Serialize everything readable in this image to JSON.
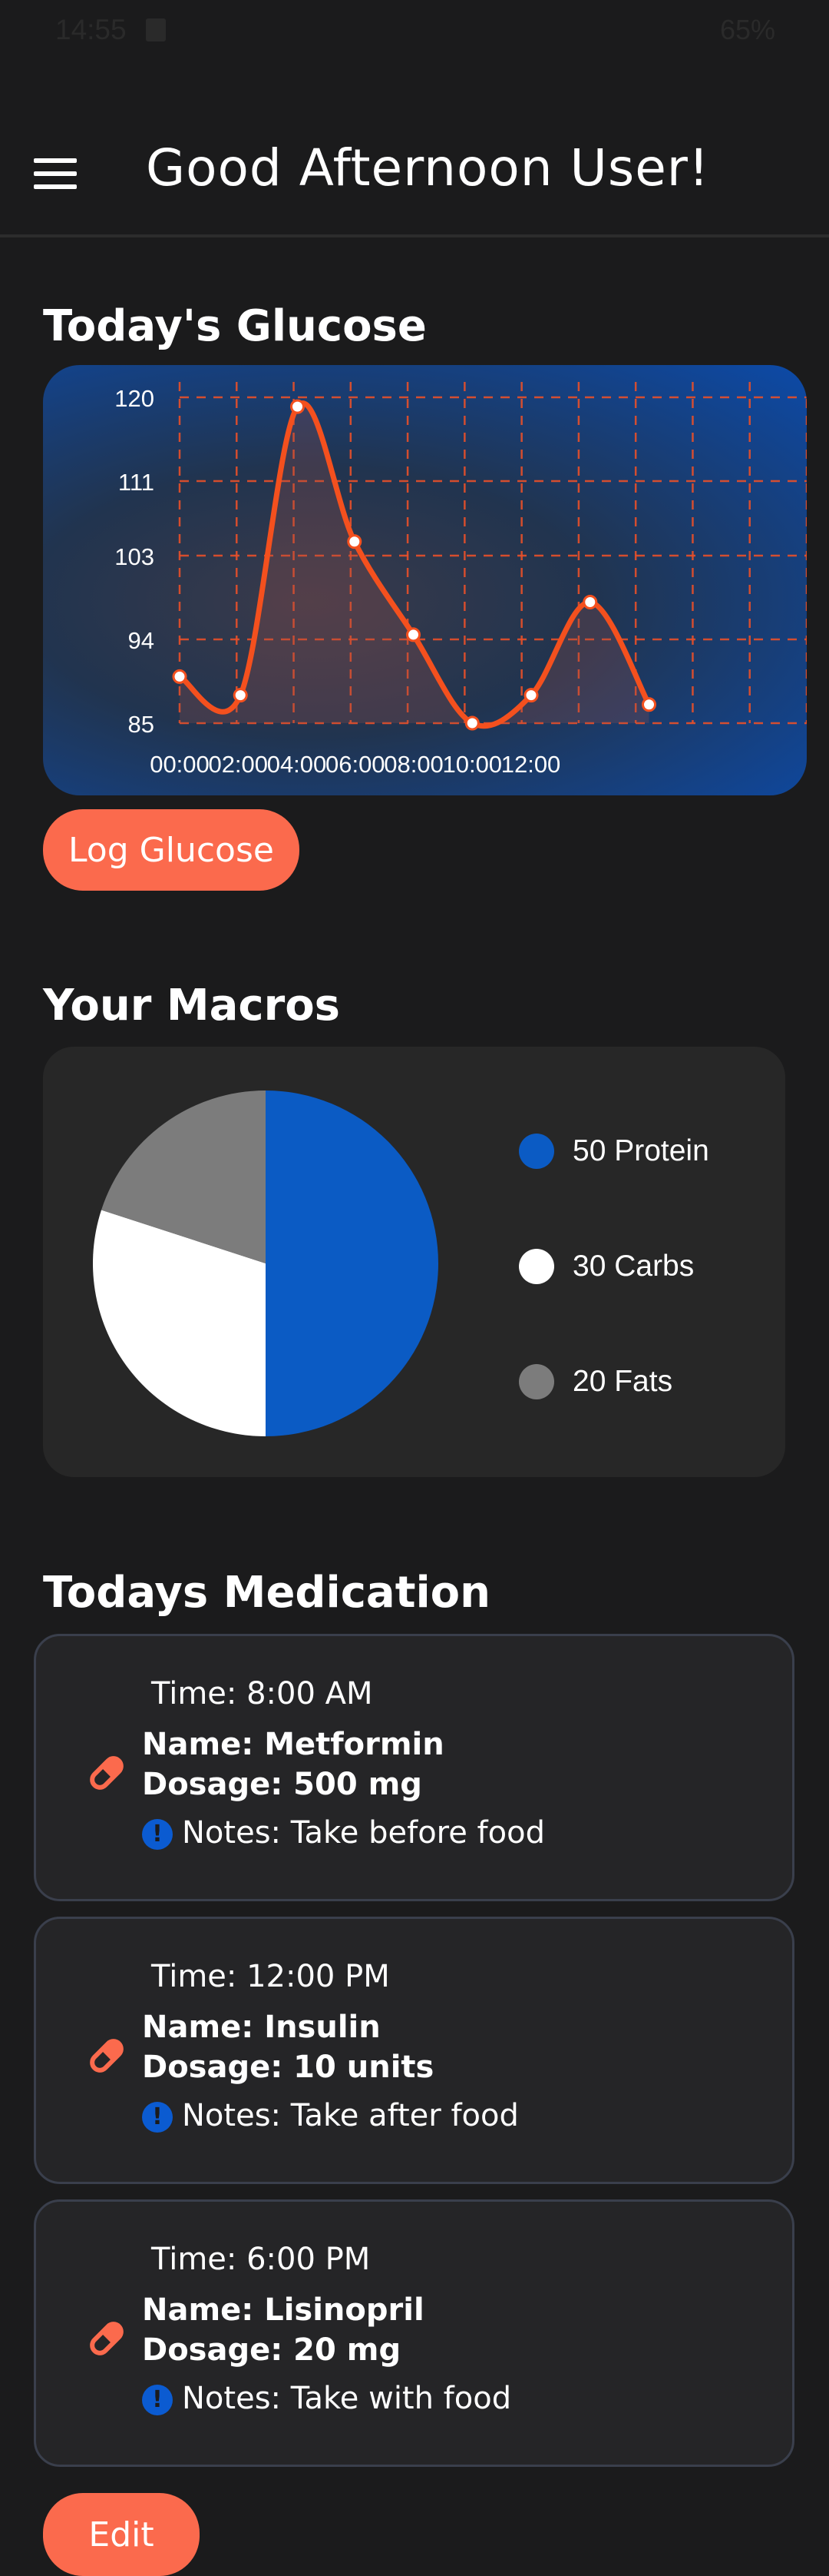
{
  "status_bar": {
    "time": "14:55",
    "battery": "65%"
  },
  "header": {
    "title": "Good Afternoon User!"
  },
  "glucose": {
    "title": "Today's Glucose",
    "log_button": "Log Glucose"
  },
  "chart_data": {
    "type": "line",
    "title": "",
    "xlabel": "",
    "ylabel": "",
    "x_ticks": [
      "00:00",
      "02:00",
      "04:00",
      "06:00",
      "08:00",
      "10:00",
      "12:00"
    ],
    "y_ticks": [
      120,
      111,
      103,
      94,
      85
    ],
    "ylim": [
      85,
      120
    ],
    "x": [
      0,
      1.5,
      3,
      4.5,
      6,
      7.5,
      9,
      10.5,
      12,
      13.5,
      15,
      16.5
    ],
    "values": [
      90,
      88,
      119,
      104.5,
      94.5,
      85,
      88,
      98,
      87
    ],
    "x_points": [
      0,
      1.6,
      3.1,
      4.6,
      6.15,
      7.7,
      9.25,
      10.8,
      12.35
    ],
    "grid": true,
    "line_color": "#f4501e",
    "point_color": "#ffffff"
  },
  "macros": {
    "title": "Your Macros",
    "items": [
      {
        "value": 50,
        "label": "50 Protein",
        "color": "#0b5bc4"
      },
      {
        "value": 30,
        "label": "30 Carbs",
        "color": "#ffffff"
      },
      {
        "value": 20,
        "label": "20 Fats",
        "color": "#7c7c7c"
      }
    ]
  },
  "medication": {
    "title": "Todays Medication",
    "items": [
      {
        "time": "Time: 8:00 AM",
        "name": "Name: Metformin",
        "dosage": "Dosage: 500 mg",
        "notes": "Notes: Take before food"
      },
      {
        "time": "Time: 12:00 PM",
        "name": "Name: Insulin",
        "dosage": "Dosage: 10 units",
        "notes": "Notes: Take after food"
      },
      {
        "time": "Time: 6:00 PM",
        "name": "Name: Lisinopril",
        "dosage": "Dosage: 20 mg",
        "notes": "Notes: Take with food"
      }
    ],
    "edit_button": "Edit"
  },
  "colors": {
    "accent": "#fb6a4d",
    "primary_blue": "#0b5bd1",
    "background": "#1b1b1c"
  },
  "icons": {
    "menu": "hamburger-menu-icon",
    "medication": "pill-icon",
    "note": "exclamation-icon"
  }
}
